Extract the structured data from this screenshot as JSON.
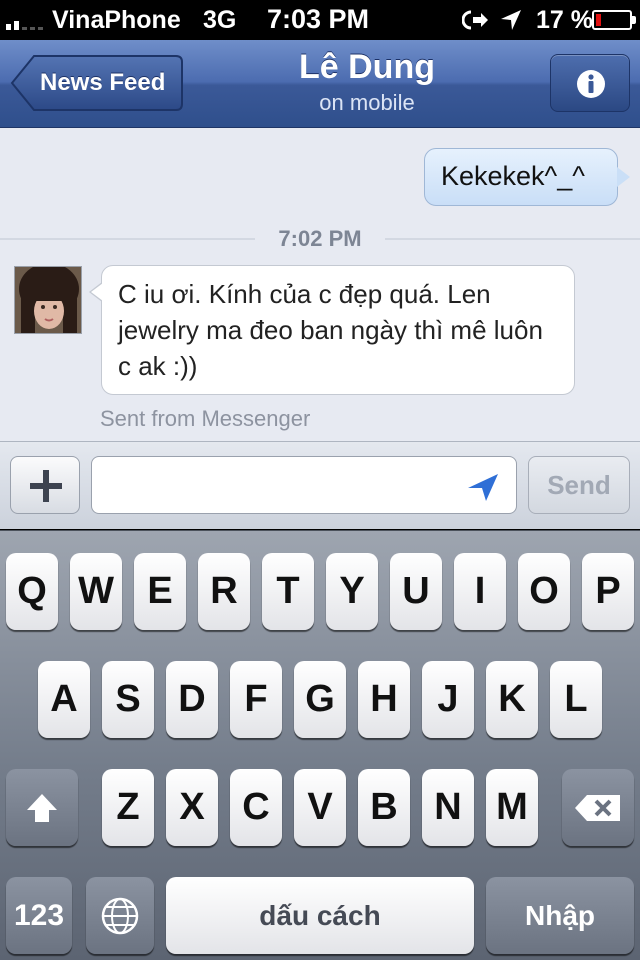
{
  "status_bar": {
    "carrier": "VinaPhone",
    "network": "3G",
    "time": "7:03 PM",
    "battery_percent": "17 %",
    "battery_level": 0.17,
    "signal_bars": 2,
    "icons": [
      "signal-icon",
      "rotation-lock-icon",
      "location-icon",
      "battery-icon"
    ],
    "battery_color": "#e11111"
  },
  "nav": {
    "back_label": "News Feed",
    "title": "Lê Dung",
    "subtitle": "on mobile",
    "info_icon": "info-icon",
    "bar_color": "#3b5998"
  },
  "chat": {
    "outgoing_message": "Kekekek^_^",
    "timestamp": "7:02 PM",
    "incoming_message": "C iu ơi. Kính của c đẹp quá. Len jewelry ma đeo ban ngày thì mê luôn c ak :))",
    "incoming_footer": "Sent from Messenger"
  },
  "composer": {
    "add_icon": "plus-icon",
    "input_value": "",
    "input_placeholder": "",
    "send_label": "Send"
  },
  "keyboard": {
    "row1": [
      "Q",
      "W",
      "E",
      "R",
      "T",
      "Y",
      "U",
      "I",
      "O",
      "P"
    ],
    "row2": [
      "A",
      "S",
      "D",
      "F",
      "G",
      "H",
      "J",
      "K",
      "L"
    ],
    "row3": [
      "Z",
      "X",
      "C",
      "V",
      "B",
      "N",
      "M"
    ],
    "numbers_label": "123",
    "space_label": "dấu cách",
    "return_label": "Nhập",
    "shift_icon": "shift-icon",
    "delete_icon": "backspace-icon",
    "globe_icon": "globe-icon"
  }
}
